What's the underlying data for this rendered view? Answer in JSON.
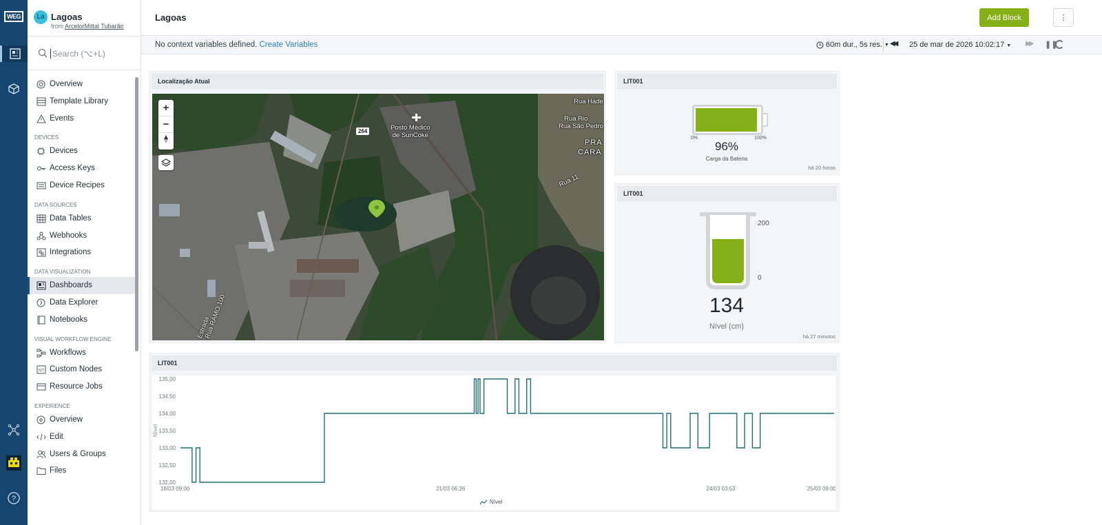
{
  "rail": {
    "logo": "WEG"
  },
  "app": {
    "badge": "La",
    "name": "Lagoas",
    "from_prefix": "from ",
    "from_org": "ArcelorMittal Tubarão"
  },
  "search": {
    "placeholder": "Search (⌥+L)"
  },
  "nav": {
    "top": [
      {
        "label": "Overview",
        "icon": "overview-icon"
      },
      {
        "label": "Template Library",
        "icon": "template-library-icon"
      },
      {
        "label": "Events",
        "icon": "events-icon"
      }
    ],
    "devices_section": "DEVICES",
    "devices": [
      {
        "label": "Devices",
        "icon": "devices-icon"
      },
      {
        "label": "Access Keys",
        "icon": "access-keys-icon"
      },
      {
        "label": "Device Recipes",
        "icon": "device-recipes-icon"
      }
    ],
    "sources_section": "DATA SOURCES",
    "sources": [
      {
        "label": "Data Tables",
        "icon": "data-tables-icon"
      },
      {
        "label": "Webhooks",
        "icon": "webhooks-icon"
      },
      {
        "label": "Integrations",
        "icon": "integrations-icon"
      }
    ],
    "viz_section": "DATA VISUALIZATION",
    "viz": [
      {
        "label": "Dashboards",
        "icon": "dashboards-icon",
        "active": true
      },
      {
        "label": "Data Explorer",
        "icon": "data-explorer-icon"
      },
      {
        "label": "Notebooks",
        "icon": "notebooks-icon"
      }
    ],
    "workflow_section": "VISUAL WORKFLOW ENGINE",
    "workflow": [
      {
        "label": "Workflows",
        "icon": "workflows-icon"
      },
      {
        "label": "Custom Nodes",
        "icon": "custom-nodes-icon"
      },
      {
        "label": "Resource Jobs",
        "icon": "resource-jobs-icon"
      }
    ],
    "experience_section": "EXPERIENCE",
    "experience": [
      {
        "label": "Overview",
        "icon": "experience-overview-icon"
      },
      {
        "label": "Edit",
        "icon": "edit-icon"
      },
      {
        "label": "Users & Groups",
        "icon": "users-groups-icon"
      },
      {
        "label": "Files",
        "icon": "files-icon"
      }
    ]
  },
  "header": {
    "title": "Lagoas",
    "add_block": "Add Block",
    "more": "⋮"
  },
  "context": {
    "message": "No context variables defined.",
    "link": "Create Variables",
    "duration": "60m dur., 5s res.",
    "date": "25 de mar de 2026 10:02:17"
  },
  "map_panel": {
    "title": "Localização Atual",
    "zoom_in": "+",
    "zoom_out": "−",
    "labels": {
      "posto": "Posto Médico\nde SunCoke",
      "road": "264",
      "rua_hade": "Rua Hade",
      "rua_rio": "Rua Rio",
      "rua_sao_pedro": "Rua São Pedro",
      "pra": "PRA",
      "cara": "CARA",
      "rua_11": "Rua 11",
      "rua_ramo": "Rua RAMO 100",
      "estrada": "Estrada"
    }
  },
  "battery_panel": {
    "title": "LIT001",
    "value_percent": 96,
    "value_text": "96%",
    "min_label": "0%",
    "max_label": "100%",
    "label": "Carga da Bateria",
    "timestamp": "há 20 horas",
    "color": "#86b017"
  },
  "tank_panel": {
    "title": "LIT001",
    "value": "134",
    "max": "200",
    "min": "0",
    "fill_fraction": 0.67,
    "label": "Nível (cm)",
    "timestamp": "há 27 minutos",
    "color": "#86b017"
  },
  "chart_panel": {
    "title": "LIT001",
    "ylabel": "Nível",
    "legend": "Nível",
    "color": "#1b6f7a",
    "y_ticks": [
      "135,00",
      "134,50",
      "134,00",
      "133,50",
      "133,00",
      "132,50",
      "132,00"
    ],
    "x_ticks": [
      "18/03 09:00",
      "21/03 06:26",
      "24/03 03:53",
      "25/03 09:00"
    ]
  },
  "chart_data": {
    "type": "line",
    "title": "LIT001",
    "xlabel": "",
    "ylabel": "Nível",
    "ylim": [
      132,
      135
    ],
    "x_range": [
      "18/03 09:00",
      "25/03 09:00"
    ],
    "grid": false,
    "legend_position": "bottom",
    "series": [
      {
        "name": "Nível",
        "x": [
          "18/03 09:00",
          "18/03 11:00",
          "18/03 12:00",
          "18/03 13:00",
          "18/03 14:00",
          "19/03 21:30",
          "19/03 22:00",
          "20/03 00:00",
          "20/03 03:00",
          "20/03 06:00",
          "21/03 12:00",
          "21/03 12:30",
          "21/03 13:00",
          "21/03 13:30",
          "21/03 14:00",
          "21/03 15:00",
          "21/03 20:00",
          "21/03 21:00",
          "21/03 23:00",
          "22/03 00:00",
          "22/03 02:00",
          "22/03 03:00",
          "23/03 12:00",
          "23/03 13:00",
          "23/03 14:00",
          "23/03 15:00",
          "23/03 20:00",
          "23/03 22:00",
          "24/03 01:00",
          "24/03 08:00",
          "24/03 10:00",
          "24/03 12:00",
          "24/03 14:00",
          "25/03 09:00"
        ],
        "y": [
          133,
          133,
          132,
          133,
          132,
          132,
          134,
          134,
          134,
          134,
          134,
          135,
          134,
          135,
          134,
          135,
          135,
          134,
          135,
          134,
          135,
          134,
          134,
          133,
          134,
          133,
          134,
          133,
          134,
          133,
          134,
          133,
          134,
          134
        ]
      }
    ]
  }
}
